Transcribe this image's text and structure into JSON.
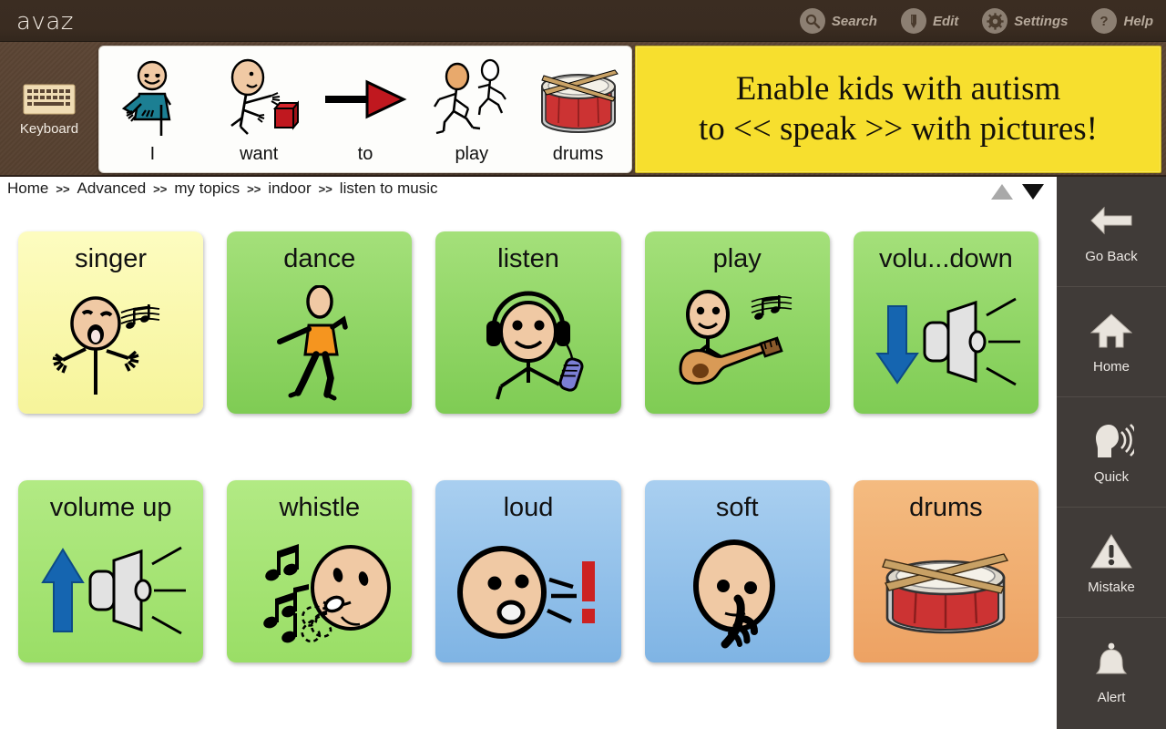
{
  "app": {
    "brand": "avaz"
  },
  "toolbar": {
    "items": [
      {
        "label": "Search",
        "icon": "search-icon"
      },
      {
        "label": "Edit",
        "icon": "pencil-icon"
      },
      {
        "label": "Settings",
        "icon": "gear-icon"
      },
      {
        "label": "Help",
        "icon": "question-icon"
      }
    ]
  },
  "keyboard_button": {
    "label": "Keyboard",
    "icon": "keyboard-icon"
  },
  "sentence_strip": {
    "words": [
      {
        "word": "I",
        "symbol": "person-pointing-self"
      },
      {
        "word": "want",
        "symbol": "person-reaching-for-block"
      },
      {
        "word": "to",
        "symbol": "right-arrow"
      },
      {
        "word": "play",
        "symbol": "two-running-figures"
      },
      {
        "word": "drums",
        "symbol": "snare-drum"
      }
    ]
  },
  "promo": {
    "line1": "Enable kids with autism",
    "line2": "to << speak >> with pictures!",
    "bg_color": "#f7df2e"
  },
  "breadcrumb": {
    "separator": ">>",
    "items": [
      "Home",
      "Advanced",
      "my topics",
      "indoor",
      "listen to music"
    ]
  },
  "scroll": {
    "up_icon": "triangle-up-icon",
    "down_icon": "triangle-down-icon"
  },
  "grid": {
    "cards": [
      {
        "label": "singer",
        "theme": "bg-yellow",
        "art": "singer"
      },
      {
        "label": "dance",
        "theme": "bg-green",
        "art": "dance"
      },
      {
        "label": "listen",
        "theme": "bg-green",
        "art": "listen"
      },
      {
        "label": "play",
        "theme": "bg-green",
        "art": "play"
      },
      {
        "label": "volu...down",
        "theme": "bg-green",
        "art": "volume-down"
      },
      {
        "label": "volume up",
        "theme": "bg-green2",
        "art": "volume-up"
      },
      {
        "label": "whistle",
        "theme": "bg-green2",
        "art": "whistle"
      },
      {
        "label": "loud",
        "theme": "bg-blue",
        "art": "loud"
      },
      {
        "label": "soft",
        "theme": "bg-blue",
        "art": "soft"
      },
      {
        "label": "drums",
        "theme": "bg-orange",
        "art": "drums"
      }
    ]
  },
  "sidebar": {
    "items": [
      {
        "label": "Go Back",
        "icon": "back-arrow-icon"
      },
      {
        "label": "Home",
        "icon": "home-icon"
      },
      {
        "label": "Quick",
        "icon": "speaking-head-icon"
      },
      {
        "label": "Mistake",
        "icon": "warning-triangle-icon"
      },
      {
        "label": "Alert",
        "icon": "bell-icon"
      }
    ]
  },
  "colors": {
    "topbar": "#3b2d22",
    "sentencebar": "#5b4534",
    "sidebar": "#403b38",
    "promo": "#f7df2e"
  }
}
